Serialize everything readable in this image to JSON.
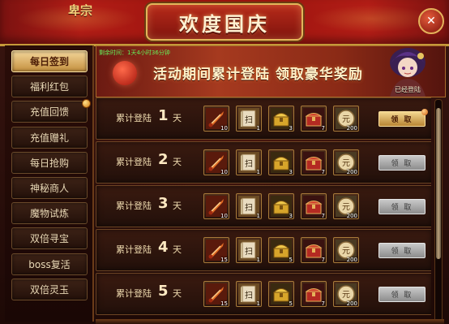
{
  "header": {
    "title": "欢度国庆",
    "corner_text": "卑宗",
    "close_symbol": "✕"
  },
  "sidebar": {
    "items": [
      {
        "label": "每日签到",
        "active": true,
        "dot": false
      },
      {
        "label": "福利红包",
        "active": false,
        "dot": false
      },
      {
        "label": "充值回馈",
        "active": false,
        "dot": true
      },
      {
        "label": "充值赠礼",
        "active": false,
        "dot": false
      },
      {
        "label": "每日抢购",
        "active": false,
        "dot": false
      },
      {
        "label": "神秘商人",
        "active": false,
        "dot": false
      },
      {
        "label": "魔物试炼",
        "active": false,
        "dot": false
      },
      {
        "label": "双倍寻宝",
        "active": false,
        "dot": false
      },
      {
        "label": "boss复活",
        "active": false,
        "dot": false
      },
      {
        "label": "双倍灵玉",
        "active": false,
        "dot": false
      }
    ]
  },
  "banner": {
    "countdown": "剩余时间：1天4小时36分钟",
    "title": "活动期间累计登陆  领取豪华奖励",
    "hero_label": "已经登陆"
  },
  "rows": [
    {
      "label": "累计登陆",
      "day": "1",
      "unit": "天",
      "counts": [
        "10",
        "1",
        "3",
        "7",
        "200"
      ],
      "claim": "领 取",
      "claimable": true
    },
    {
      "label": "累计登陆",
      "day": "2",
      "unit": "天",
      "counts": [
        "10",
        "1",
        "3",
        "7",
        "200"
      ],
      "claim": "领 取",
      "claimable": false
    },
    {
      "label": "累计登陆",
      "day": "3",
      "unit": "天",
      "counts": [
        "10",
        "1",
        "3",
        "7",
        "200"
      ],
      "claim": "领 取",
      "claimable": false
    },
    {
      "label": "累计登陆",
      "day": "4",
      "unit": "天",
      "counts": [
        "15",
        "1",
        "5",
        "7",
        "200"
      ],
      "claim": "领 取",
      "claimable": false
    },
    {
      "label": "累计登陆",
      "day": "5",
      "unit": "天",
      "counts": [
        "15",
        "1",
        "5",
        "7",
        "200"
      ],
      "claim": "领 取",
      "claimable": false
    }
  ],
  "reward_icons": [
    "sword-icon",
    "scroll-icon",
    "gold-chest-icon",
    "red-chest-icon",
    "coin-icon"
  ],
  "reward_badge_text": "扫",
  "coin_text": "元",
  "colors": {
    "accent_gold": "#e3b55a",
    "banner_red": "#9e150f",
    "active_tab": "#f4d69a",
    "countdown_green": "#64f25a"
  }
}
